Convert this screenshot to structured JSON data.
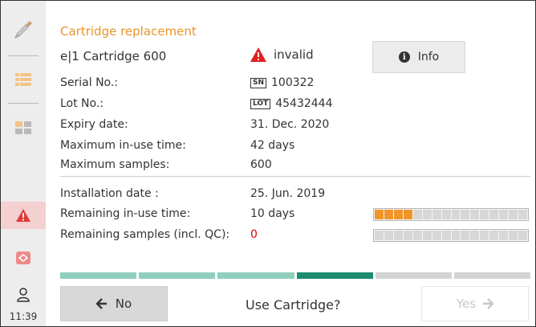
{
  "sidebar": {
    "time": "11:39",
    "icons": [
      "pipette-icon",
      "list-icon",
      "grid-icon",
      "warning-icon",
      "cartridge-icon",
      "user-icon"
    ]
  },
  "header": {
    "title": "Cartridge replacement",
    "cartridge_name": "e|1 Cartridge 600",
    "status": "invalid",
    "info_label": "Info"
  },
  "fields": {
    "serial": {
      "label": "Serial No.:",
      "tag": "SN",
      "value": "100322"
    },
    "lot": {
      "label": "Lot No.:",
      "tag": "LOT",
      "value": "45432444"
    },
    "expiry": {
      "label": "Expiry date:",
      "value": "31. Dec. 2020"
    },
    "max_time": {
      "label": "Maximum in-use time:",
      "value": "42 days"
    },
    "max_samples": {
      "label": "Maximum samples:",
      "value": "600"
    },
    "install": {
      "label": "Installation date :",
      "value": "25. Jun. 2019"
    },
    "remain_time": {
      "label": "Remaining in-use time:",
      "value": "10 days",
      "bar_fraction": 0.25
    },
    "remain_samples": {
      "label": "Remaining samples (incl. QC):",
      "value": "0",
      "bar_fraction": 0
    }
  },
  "wizard": {
    "steps_total": 6,
    "current_step": 4,
    "colors": {
      "done": "#8fcfbd",
      "current": "#1e8a70",
      "todo": "#d3d3d3"
    }
  },
  "footer": {
    "no_label": "No",
    "question": "Use Cartridge?",
    "yes_label": "Yes"
  },
  "colors": {
    "accent": "#e8952a",
    "alert": "#e00000",
    "bar_on": "#f0952a"
  }
}
